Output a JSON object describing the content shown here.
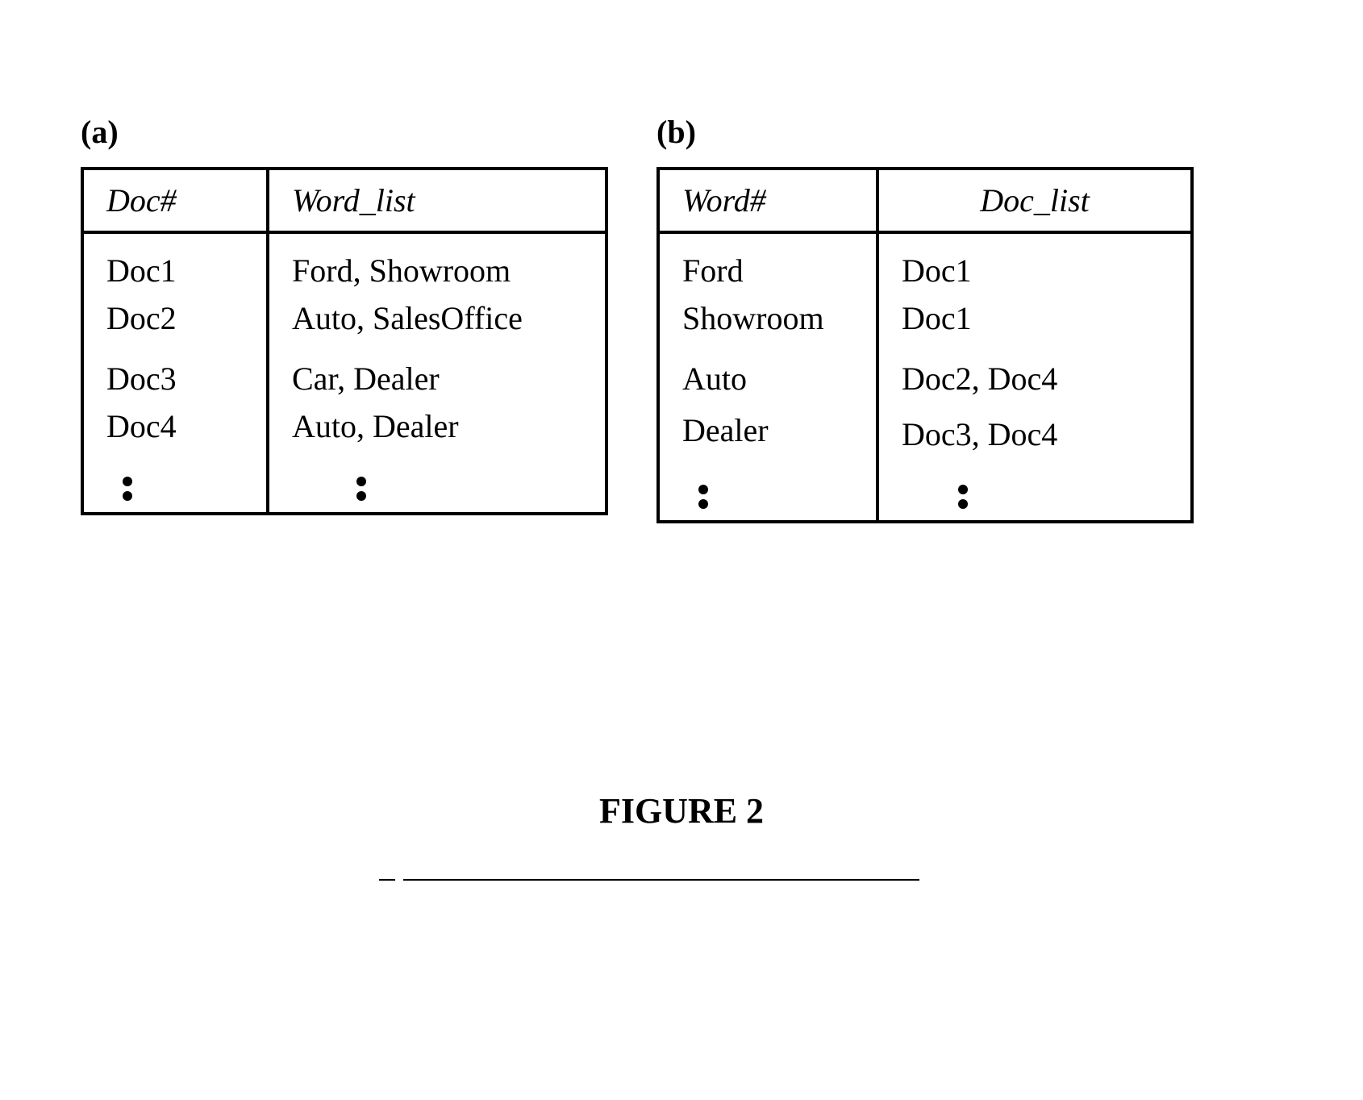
{
  "table_a": {
    "label": "(a)",
    "header_col1": "Doc#",
    "header_col2": "Word_list",
    "rows": [
      {
        "c1": "Doc1",
        "c2": "Ford, Showroom"
      },
      {
        "c1": "Doc2",
        "c2": "Auto, SalesOffice"
      },
      {
        "c1": "Doc3",
        "c2": "Car, Dealer"
      },
      {
        "c1": "Doc4",
        "c2": "Auto, Dealer"
      }
    ]
  },
  "table_b": {
    "label": "(b)",
    "header_col1": "Word#",
    "header_col2": "Doc_list",
    "rows": [
      {
        "c1": "Ford",
        "c2": "Doc1"
      },
      {
        "c1": "Showroom",
        "c2": "Doc1"
      },
      {
        "c1": "Auto",
        "c2": "Doc2, Doc4"
      },
      {
        "c1": "Dealer",
        "c2": "Doc3, Doc4"
      }
    ]
  },
  "caption": "FIGURE 2"
}
